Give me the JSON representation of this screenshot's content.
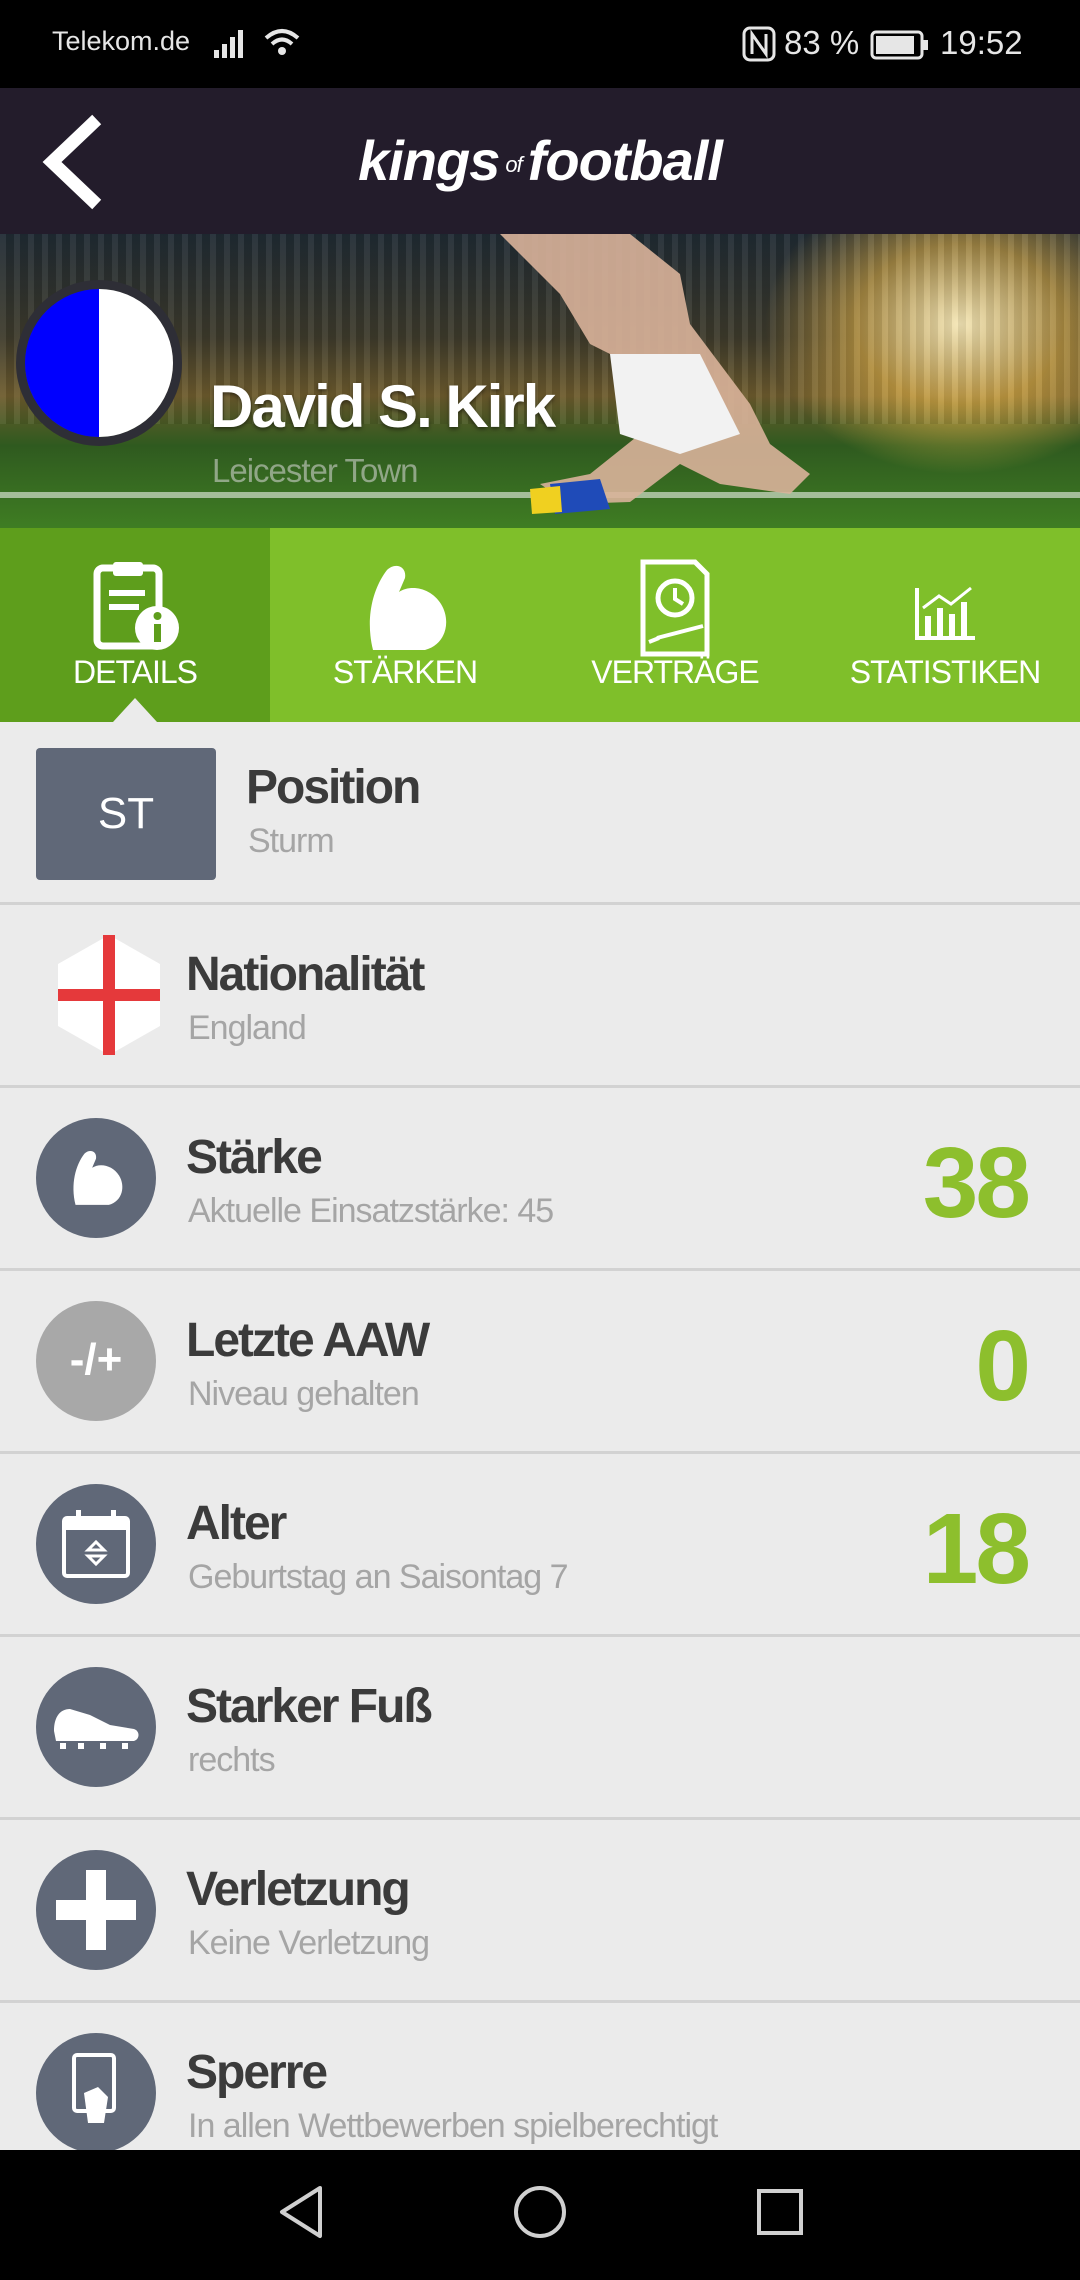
{
  "status_bar": {
    "carrier": "Telekom.de",
    "battery": "83 %",
    "time": "19:52",
    "icons": [
      "signal-icon",
      "wifi-icon",
      "nfc-icon",
      "battery-icon"
    ]
  },
  "header": {
    "logo_part1": "kings",
    "logo_part2": "of",
    "logo_part3": "football"
  },
  "player": {
    "name": "David S. Kirk",
    "club": "Leicester Town",
    "club_colors": [
      "#0000ff",
      "#ffffff"
    ]
  },
  "tabs": [
    {
      "label": "DETAILS",
      "icon": "clipboard-info-icon",
      "active": true
    },
    {
      "label": "STÄRKEN",
      "icon": "flexed-arm-icon",
      "active": false
    },
    {
      "label": "VERTRÄGE",
      "icon": "contract-icon",
      "active": false
    },
    {
      "label": "STATISTIKEN",
      "icon": "chart-icon",
      "active": false
    }
  ],
  "details": [
    {
      "badge": "ST",
      "title": "Position",
      "subtitle": "Sturm"
    },
    {
      "icon": "england-flag-icon",
      "title": "Nationalität",
      "subtitle": "England"
    },
    {
      "icon": "flexed-arm-icon",
      "title": "Stärke",
      "subtitle": "Aktuelle Einsatzstärke: 45",
      "value": "38"
    },
    {
      "icon": "minus-plus-icon",
      "icon_text": "-/+",
      "title": "Letzte AAW",
      "subtitle": "Niveau gehalten",
      "value": "0"
    },
    {
      "icon": "calendar-icon",
      "title": "Alter",
      "subtitle": "Geburtstag an Saisontag 7",
      "value": "18"
    },
    {
      "icon": "boot-icon",
      "title": "Starker Fuß",
      "subtitle": "rechts"
    },
    {
      "icon": "cross-icon",
      "title": "Verletzung",
      "subtitle": "Keine Verletzung"
    },
    {
      "icon": "card-icon",
      "title": "Sperre",
      "subtitle": "In allen Wettbewerben spielberechtigt"
    }
  ],
  "colors": {
    "header_bg": "#231c2b",
    "tab_bg": "#7fbf2a",
    "tab_active_bg": "#5e9e1c",
    "value_green": "#8dbf2d",
    "icon_bg": "#606878"
  },
  "nav_bar": [
    "back-icon",
    "home-icon",
    "recents-icon"
  ]
}
